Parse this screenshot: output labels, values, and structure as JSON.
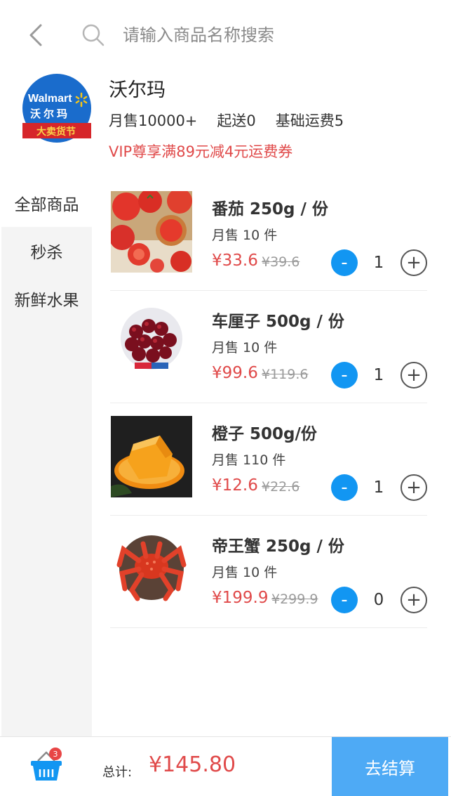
{
  "header": {
    "search_placeholder": "请输入商品名称搜索",
    "back_icon": "chevron-left-icon",
    "search_icon": "search-icon"
  },
  "store": {
    "logo_text": "Walmart",
    "logo_subtext": "沃尔玛",
    "logo_banner": "大卖货节",
    "name": "沃尔玛",
    "monthly_sales": "月售10000+",
    "min_order": "起送0",
    "base_delivery": "基础运费5",
    "promo": "VIP尊享满89元减4元运费券"
  },
  "categories": [
    {
      "label": "全部商品",
      "active": true
    },
    {
      "label": "秒杀",
      "active": false
    },
    {
      "label": "新鲜水果",
      "active": false
    }
  ],
  "products": [
    {
      "name": "番茄 250g / 份",
      "sales": "月售 10 件",
      "price": "¥33.6",
      "original_price": "¥39.6",
      "qty": "1",
      "image": "tomato"
    },
    {
      "name": "车厘子 500g / 份",
      "sales": "月售 10 件",
      "price": "¥99.6",
      "original_price": "¥119.6",
      "qty": "1",
      "image": "cherry"
    },
    {
      "name": "橙子 500g/份",
      "sales": "月售 110 件",
      "price": "¥12.6",
      "original_price": "¥22.6",
      "qty": "1",
      "image": "orange"
    },
    {
      "name": "帝王蟹 250g / 份",
      "sales": "月售 10 件",
      "price": "¥199.9",
      "original_price": "¥299.9",
      "qty": "0",
      "image": "crab"
    }
  ],
  "controls": {
    "minus": "-",
    "plus": "+"
  },
  "cart": {
    "badge": "3",
    "total_label": "总计:",
    "total": "¥145.80",
    "checkout": "去结算"
  },
  "colors": {
    "accent_blue": "#1296f2",
    "checkout_blue": "#4eaaf5",
    "price_red": "#e04a4a"
  }
}
